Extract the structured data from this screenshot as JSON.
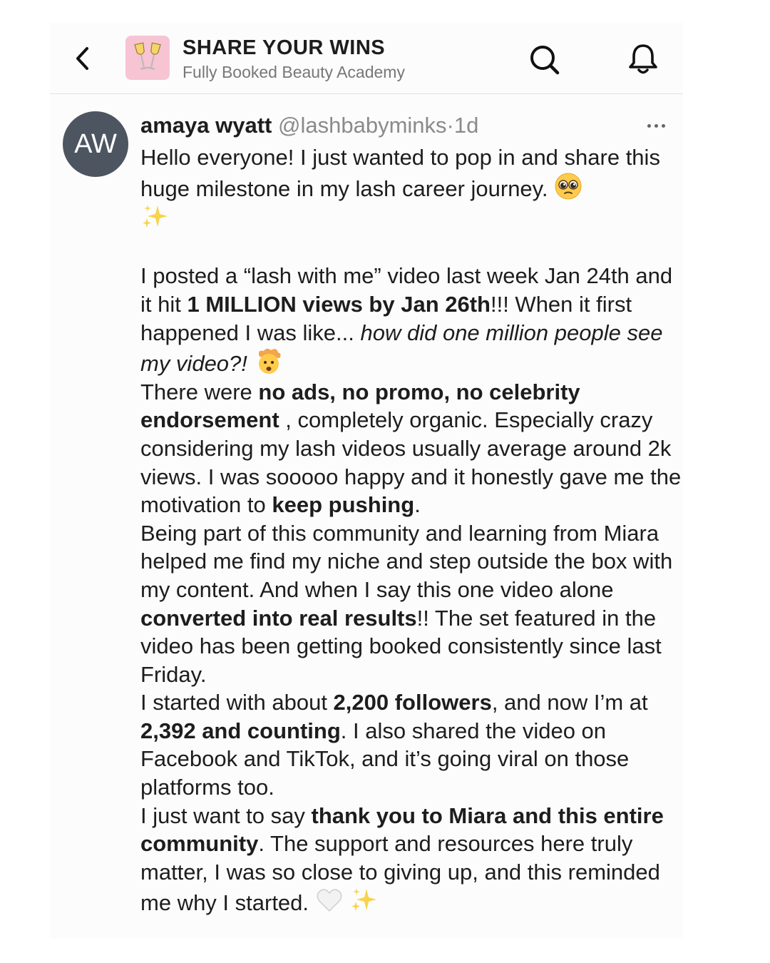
{
  "header": {
    "back_icon": "chevron-left-icon",
    "space_icon": "champagne-glasses-icon",
    "space_icon_bg": "#f7c4d4",
    "title": "SHARE YOUR WINS",
    "subtitle": "Fully Booked Beauty Academy",
    "search_icon": "search-icon",
    "bell_icon": "bell-icon"
  },
  "post": {
    "avatar_initials": "AW",
    "avatar_color": "#4c5560",
    "author_name": "amaya wyatt",
    "handle": "@lashbabyminks",
    "separator": "·",
    "time": "1d",
    "more_icon": "more-horizontal-icon",
    "p1": "Hello everyone! I just wanted to pop in and share this huge milestone in my lash career journey.",
    "p1_emojis": [
      "pleading-face-icon",
      "sparkles-icon"
    ],
    "p2a": "I posted a “lash with me” video last week Jan 24th and it hit ",
    "p2b": "1 MILLION views by Jan 26th",
    "p2c": "!!! When it first happened I was like... ",
    "p2d": "how did one million people see my video?!",
    "p2_emoji": "exploding-head-icon",
    "p3a": "There were ",
    "p3b": "no ads, no promo, no celebrity endorsement",
    "p3c": " , completely organic. Especially crazy considering my lash videos usually average around 2k views. I was sooooo happy and it honestly gave me the motivation to ",
    "p3d": "keep pushing",
    "p3e": ".",
    "p4a": "Being part of this community and learning from Miara helped me find my niche and step outside the box with my content. And when I say this one video alone ",
    "p4b": "converted into real results",
    "p4c": "!!  The set featured in the video has been getting booked consistently since last Friday.",
    "p5a": "I started with about ",
    "p5b": "2,200 followers",
    "p5c": ", and now I’m at ",
    "p5d": "2,392 and counting",
    "p5e": ". I also shared the video on Facebook and TikTok, and it’s going viral on those platforms too.",
    "p6a": "I just want to say ",
    "p6b": "thank you to Miara and this entire community",
    "p6c": ". The support and resources here truly matter, I was so close to giving up, and this reminded me why I started.",
    "p6_emojis": [
      "white-heart-icon",
      "sparkles-icon"
    ]
  }
}
